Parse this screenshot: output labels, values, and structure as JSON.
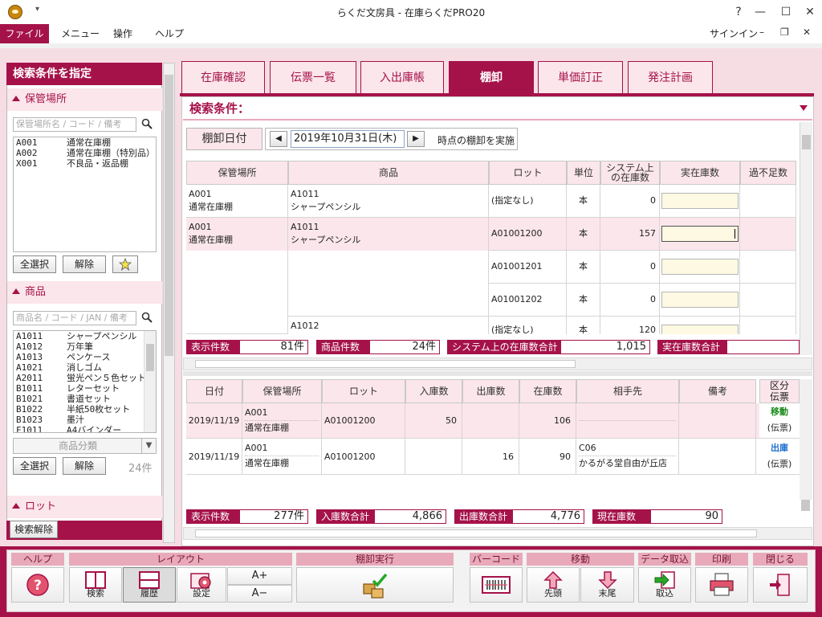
{
  "window": {
    "title": "らくだ文房具 - 在庫らくだPRO20",
    "help_btn": "?",
    "minimize_btn": "—",
    "maximize_btn": "☐",
    "close_btn": "✕"
  },
  "menu": {
    "items": [
      "ファイル",
      "メニュー",
      "操作",
      "ヘルプ"
    ],
    "signin": "サインイン",
    "sub_min": "–",
    "sub_restore": "❐",
    "sub_close": "✕"
  },
  "left": {
    "header": "検索条件を指定",
    "location": {
      "title": "保管場所",
      "placeholder": "保管場所名 / コード / 備考",
      "items": [
        {
          "code": "A001",
          "name": "通常在庫棚"
        },
        {
          "code": "A002",
          "name": "通常在庫棚（特別品）"
        },
        {
          "code": "X001",
          "name": "不良品・返品棚"
        }
      ],
      "select_all": "全選択",
      "clear": "解除",
      "star": "☆"
    },
    "product": {
      "title": "商品",
      "placeholder": "商品名 / コード / JAN / 備考",
      "items": [
        {
          "code": "A1011",
          "name": "シャープペンシル"
        },
        {
          "code": "A1012",
          "name": "万年筆"
        },
        {
          "code": "A1013",
          "name": "ペンケース"
        },
        {
          "code": "A1021",
          "name": "消しゴム"
        },
        {
          "code": "A2011",
          "name": "蛍光ペン５色セット"
        },
        {
          "code": "B1011",
          "name": "レターセット"
        },
        {
          "code": "B1021",
          "name": "書道セット"
        },
        {
          "code": "B1022",
          "name": "半紙50枚セット"
        },
        {
          "code": "B1023",
          "name": "墨汁"
        },
        {
          "code": "F1011",
          "name": "A4バインダー"
        }
      ],
      "category_placeholder": "商品分類",
      "select_all": "全選択",
      "clear": "解除",
      "count": "24件"
    },
    "lot": {
      "title": "ロット"
    },
    "filter_clear": "検索解除"
  },
  "tabs": [
    {
      "label": "在庫確認",
      "active": false
    },
    {
      "label": "伝票一覧",
      "active": false
    },
    {
      "label": "入出庫帳",
      "active": false
    },
    {
      "label": "棚卸",
      "active": true
    },
    {
      "label": "単価訂正",
      "active": false
    },
    {
      "label": "発注計画",
      "active": false
    }
  ],
  "condition": {
    "title": "検索条件：",
    "date_label": "棚卸日付",
    "date_value": "2019年10月31日(木)",
    "date_suffix": "時点の棚卸を実施",
    "prev": "◀",
    "next": "▶"
  },
  "upper_grid": {
    "headers": [
      "保管場所",
      "商品",
      "ロット",
      "単位",
      "システム上の在庫数",
      "実在庫数",
      "過不足数"
    ],
    "rows": [
      {
        "location": "A001",
        "location_name": "通常在庫棚",
        "product": "A1011",
        "product_name": "シャープペンシル",
        "lot": "(指定なし)",
        "unit": "本",
        "system": "0"
      },
      {
        "location": "A001",
        "location_name": "通常在庫棚",
        "product": "A1011",
        "product_name": "シャープペンシル",
        "lot": "A01001200",
        "unit": "本",
        "system": "157"
      },
      {
        "lot": "A01001201",
        "unit": "本",
        "system": "0"
      },
      {
        "lot": "A01001202",
        "unit": "本",
        "system": "0"
      },
      {
        "product": "A1012",
        "lot": "(指定なし)",
        "unit": "本",
        "system": "120"
      }
    ]
  },
  "upper_summary": {
    "display_label": "表示件数",
    "display_value": "81件",
    "product_label": "商品件数",
    "product_value": "24件",
    "system_label": "システム上の在庫数合計",
    "system_value": "1,015",
    "actual_label": "実在庫数合計"
  },
  "lower_grid": {
    "headers": [
      "日付",
      "保管場所",
      "ロット",
      "入庫数",
      "出庫数",
      "在庫数",
      "相手先",
      "備考",
      "区分",
      "伝票"
    ],
    "rows": [
      {
        "date": "2019/11/19",
        "location": "A001",
        "location_name": "通常在庫棚",
        "lot": "A01001200",
        "in": "50",
        "out": "",
        "stock": "106",
        "partner_code": "",
        "partner_name": "",
        "kind": "移動",
        "slip": "(伝票)"
      },
      {
        "date": "2019/11/19",
        "location": "A001",
        "location_name": "通常在庫棚",
        "lot": "A01001200",
        "in": "",
        "out": "16",
        "stock": "90",
        "partner_code": "C06",
        "partner_name": "かるがる堂自由が丘店",
        "kind": "出庫",
        "slip": "(伝票)"
      }
    ]
  },
  "lower_summary": {
    "display_label": "表示件数",
    "display_value": "277件",
    "in_label": "入庫数合計",
    "in_value": "4,866",
    "out_label": "出庫数合計",
    "out_value": "4,776",
    "stock_label": "現在庫数",
    "stock_value": "90"
  },
  "toolbar": {
    "help_group": "ヘルプ",
    "layout_group": "レイアウト",
    "layout_search": "検索",
    "layout_history": "履歴",
    "layout_settings": "設定",
    "font_up": "A+",
    "font_down": "A−",
    "inventory_group": "棚卸実行",
    "barcode_group": "バーコード",
    "move_group": "移動",
    "move_first": "先頭",
    "move_last": "末尾",
    "import_group": "データ取込",
    "import_btn": "取込",
    "print_group": "印刷",
    "close_group": "閉じる"
  },
  "colors": {
    "brand": "#a51249",
    "brand_light": "#fbe6eb",
    "move_green": "#1a8a1a",
    "out_blue": "#1f6fd0"
  }
}
